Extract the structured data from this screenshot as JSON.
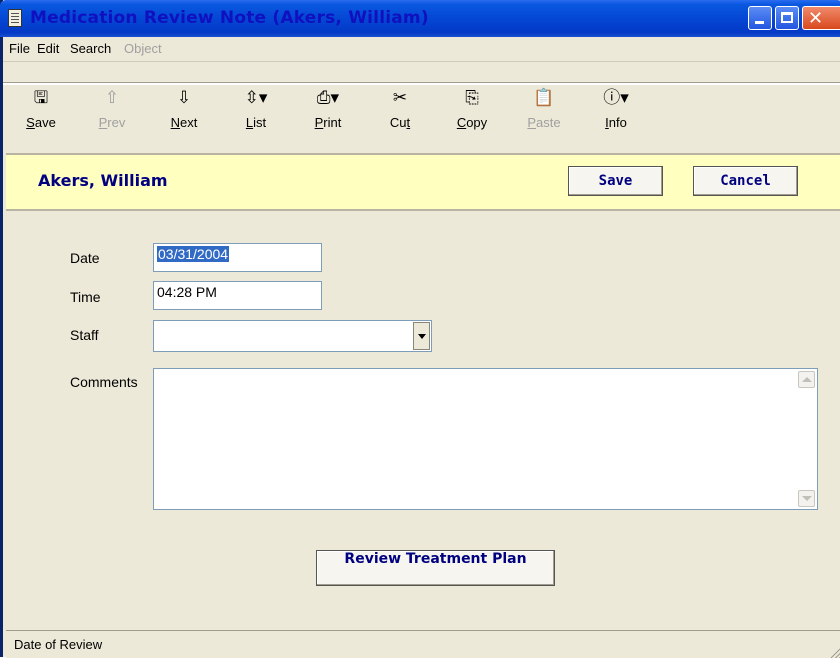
{
  "window": {
    "title": "Medication Review Note (Akers, William)",
    "controls": [
      "minimize",
      "maximize",
      "close"
    ]
  },
  "menubar": {
    "items": [
      {
        "label": "File",
        "enabled": true
      },
      {
        "label": "Edit",
        "enabled": true
      },
      {
        "label": "Search",
        "enabled": true
      },
      {
        "label": "Object",
        "enabled": false
      }
    ]
  },
  "toolbar": {
    "buttons": [
      {
        "icon": "save-icon",
        "glyph": "🖫",
        "label": "Save",
        "ul": "S",
        "rest": "ave",
        "enabled": true
      },
      {
        "icon": "prev-arrow-icon",
        "glyph": "⇧",
        "label": "Prev",
        "ul": "P",
        "rest": "rev",
        "enabled": false
      },
      {
        "icon": "next-arrow-icon",
        "glyph": "⇩",
        "label": "Next",
        "ul": "N",
        "rest": "ext",
        "enabled": true
      },
      {
        "icon": "list-icon",
        "glyph": "⇳▾",
        "label": "List",
        "ul": "L",
        "rest": "ist",
        "enabled": true
      },
      {
        "icon": "print-icon",
        "glyph": "⎙▾",
        "label": "Print",
        "ul": "P",
        "rest": "rint",
        "enabled": true
      },
      {
        "icon": "cut-icon",
        "glyph": "✂",
        "label": "Cut",
        "pre": "Cu",
        "ul": "t",
        "enabled": true
      },
      {
        "icon": "copy-icon",
        "glyph": "⎘",
        "label": "Copy",
        "ul": "C",
        "rest": "opy",
        "enabled": true
      },
      {
        "icon": "paste-icon",
        "glyph": "📋",
        "label": "Paste",
        "ul": "P",
        "rest": "aste",
        "enabled": false
      },
      {
        "icon": "info-icon",
        "glyph": "ⓘ▾",
        "label": "Info",
        "ul": "I",
        "rest": "nfo",
        "enabled": true
      }
    ]
  },
  "header": {
    "patient_name": "Akers, William",
    "save_label": "Save",
    "cancel_label": "Cancel"
  },
  "form": {
    "date_label": "Date",
    "date_value": "03/31/2004",
    "time_label": "Time",
    "time_value": "04:28 PM",
    "staff_label": "Staff",
    "staff_value": "",
    "comments_label": "Comments",
    "comments_value": ""
  },
  "review_button_label": "Review Treatment Plan",
  "status": {
    "text": "Date of Review"
  },
  "colors": {
    "title_text": "#1010c0",
    "header_band": "#ffffc0",
    "button_text": "#000080",
    "selection": "#316ac5"
  }
}
